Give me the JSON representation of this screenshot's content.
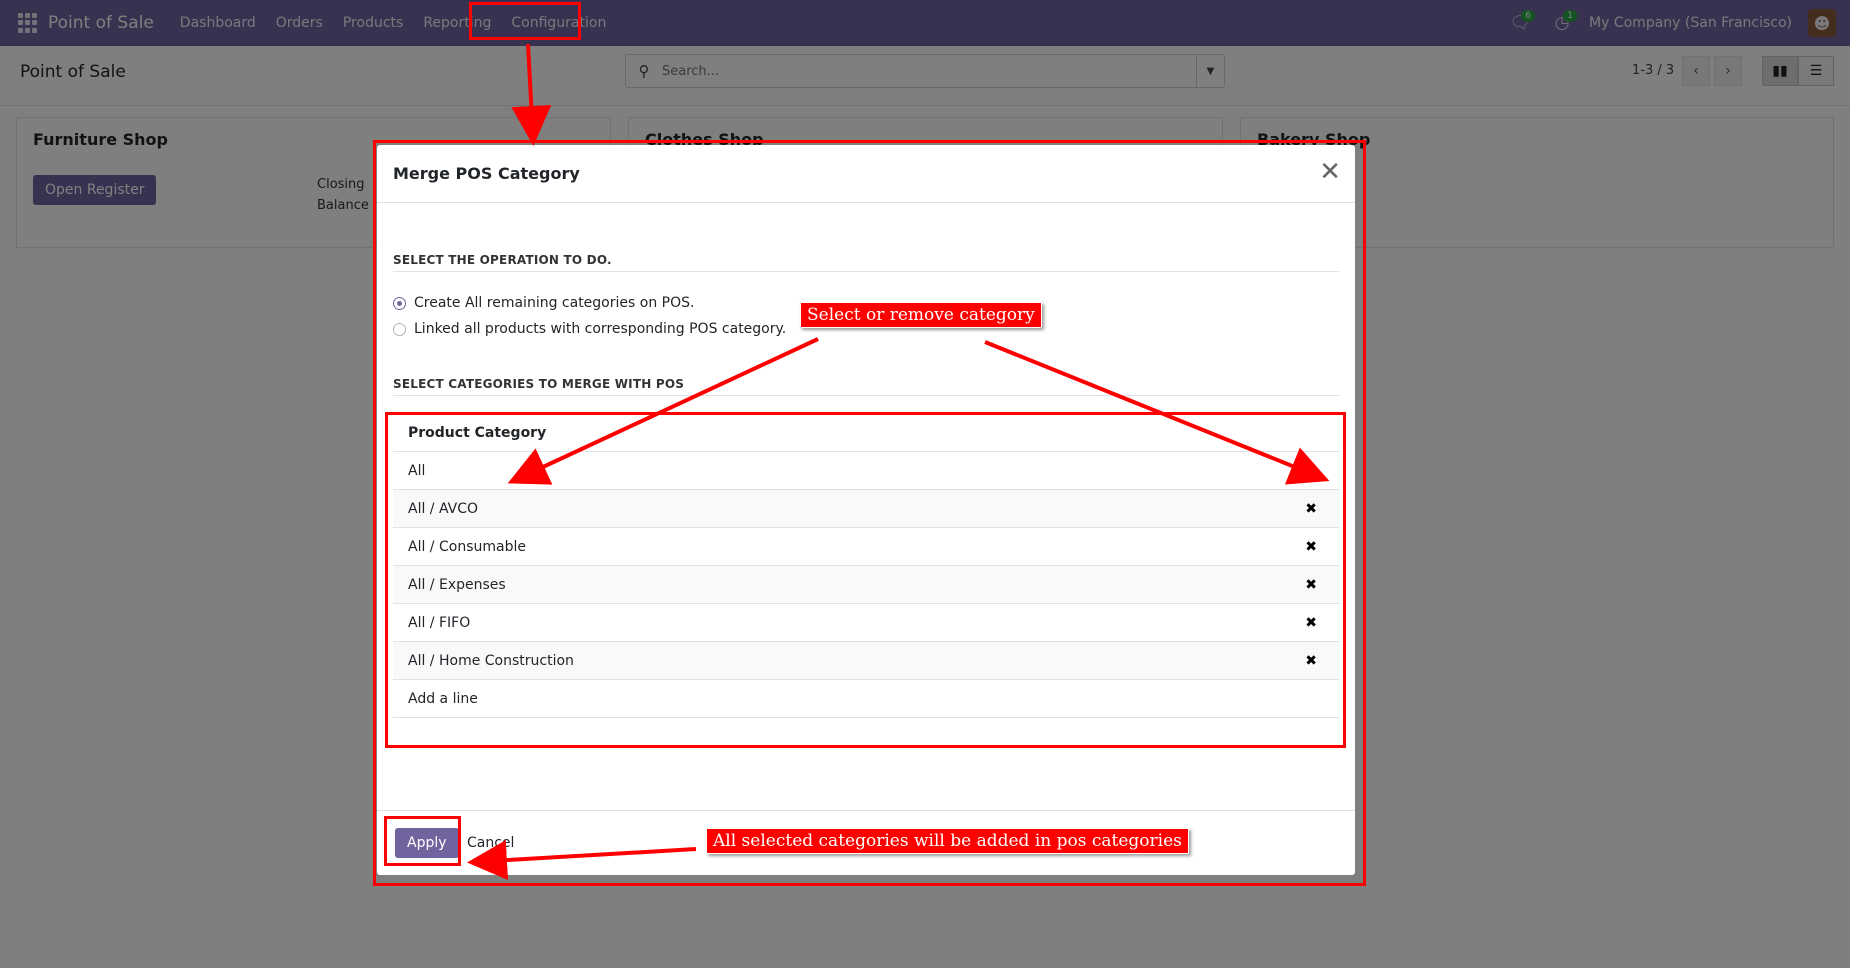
{
  "navbar": {
    "app_name": "Point of Sale",
    "menu": [
      "Dashboard",
      "Orders",
      "Products",
      "Reporting",
      "Configuration"
    ],
    "chat_badge": "6",
    "activity_badge": "1",
    "company": "My Company (San Francisco)"
  },
  "control_panel": {
    "breadcrumb": "Point of Sale",
    "search_placeholder": "Search...",
    "pager": "1-3 / 3"
  },
  "cards": [
    {
      "title": "Furniture Shop",
      "button": "Open Register",
      "closing_1": "Closing",
      "closing_2": "Balance"
    },
    {
      "title": "Clothes Shop"
    },
    {
      "title": "Bakery Shop"
    }
  ],
  "modal": {
    "title": "Merge POS Category",
    "operation_heading": "SELECT THE OPERATION TO DO.",
    "options": [
      "Create All remaining categories on POS.",
      "Linked all products with corresponding POS category."
    ],
    "selected_option": 0,
    "categories_heading": "SELECT CATEGORIES TO MERGE WITH POS",
    "table_header": "Product Category",
    "rows": [
      "All",
      "All / AVCO",
      "All / Consumable",
      "All / Expenses",
      "All / FIFO",
      "All / Home Construction"
    ],
    "add_line": "Add a line",
    "apply": "Apply",
    "cancel": "Cancel"
  },
  "annotations": {
    "select_remove": "Select or remove category",
    "all_selected": "All selected categories will be added in pos categories"
  },
  "colors": {
    "brand": "#71639e",
    "annotation": "#ff0000"
  }
}
